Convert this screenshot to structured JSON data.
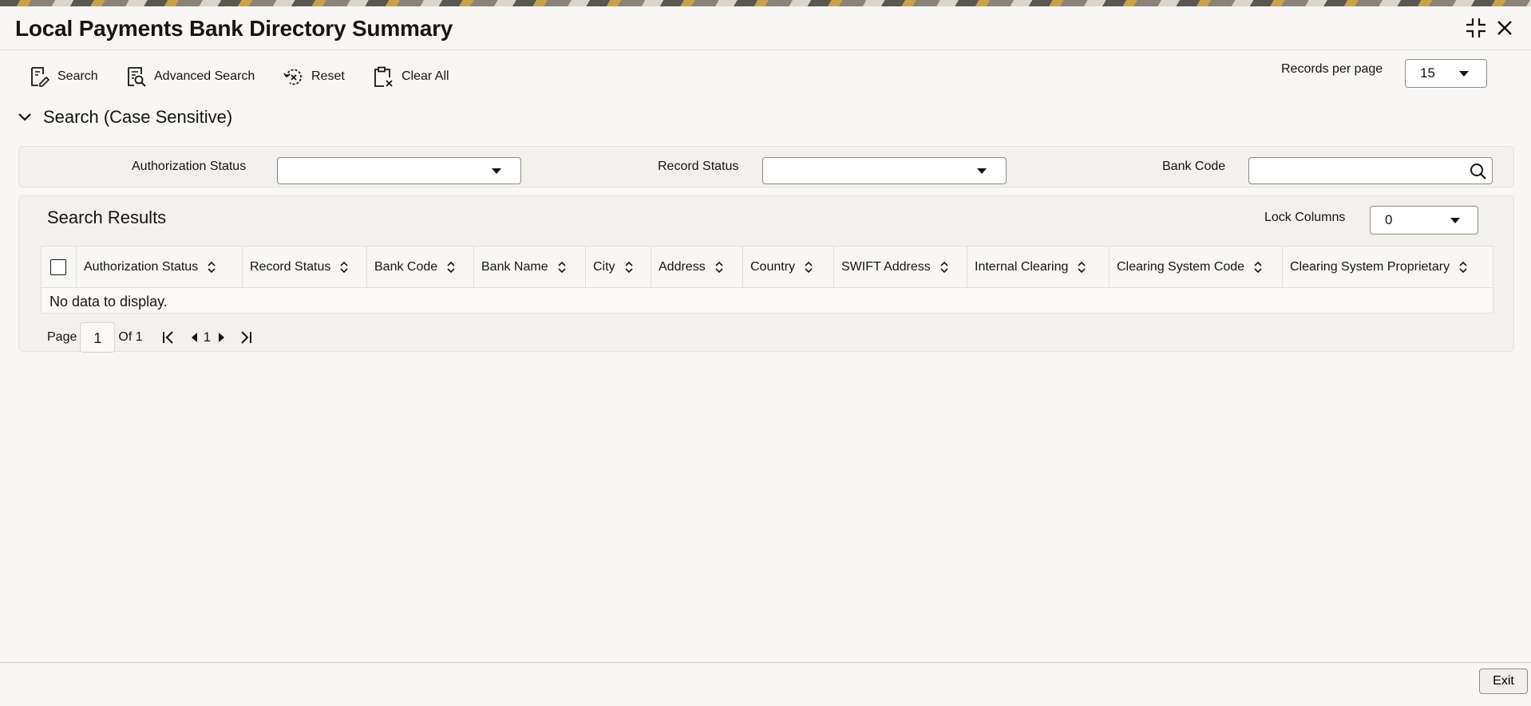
{
  "window": {
    "title": "Local Payments Bank Directory Summary",
    "collapse_icon": "collapse-icon",
    "close_icon": "close-icon"
  },
  "toolbar": {
    "search_label": "Search",
    "advanced_search_label": "Advanced Search",
    "reset_label": "Reset",
    "clear_all_label": "Clear All",
    "records_per_page_label": "Records per page",
    "records_per_page_value": "15"
  },
  "search_section": {
    "title": "Search (Case Sensitive)",
    "authorization_status_label": "Authorization Status",
    "authorization_status_value": "",
    "record_status_label": "Record Status",
    "record_status_value": "",
    "bank_code_label": "Bank Code",
    "bank_code_value": ""
  },
  "results": {
    "title": "Search Results",
    "lock_columns_label": "Lock Columns",
    "lock_columns_value": "0",
    "columns": [
      "Authorization Status",
      "Record Status",
      "Bank Code",
      "Bank Name",
      "City",
      "Address",
      "Country",
      "SWIFT Address",
      "Internal Clearing",
      "Clearing System Code",
      "Clearing System Proprietary"
    ],
    "empty_message": "No data to display."
  },
  "pagination": {
    "page_label": "Page",
    "current_page": "1",
    "of_label": "Of 1",
    "page_number": "1"
  },
  "footer": {
    "exit_label": "Exit"
  },
  "colors": {
    "background": "#f8f7f5",
    "panel": "#f3f1ee",
    "text": "#161513",
    "border": "#8f8b85"
  }
}
